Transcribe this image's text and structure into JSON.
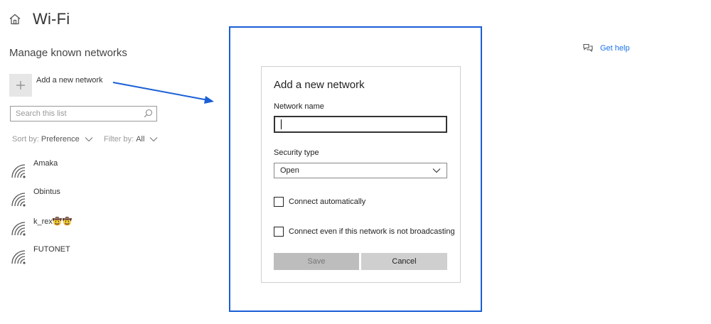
{
  "header": {
    "title": "Wi-Fi",
    "section_title": "Manage known networks"
  },
  "add_network": {
    "label": "Add a new network"
  },
  "search": {
    "placeholder": "Search this list",
    "value": ""
  },
  "sort": {
    "label": "Sort by:",
    "value": "Preference"
  },
  "filter": {
    "label": "Filter by:",
    "value": "All"
  },
  "networks": [
    {
      "name": "Amaka"
    },
    {
      "name": "Obintus"
    },
    {
      "name": "k_rex🤠🤠"
    },
    {
      "name": "FUTONET"
    }
  ],
  "help": {
    "label": "Get help"
  },
  "dialog": {
    "title": "Add a new network",
    "network_name_label": "Network name",
    "network_name_value": "",
    "security_type_label": "Security type",
    "security_type_value": "Open",
    "connect_auto_label": "Connect automatically",
    "connect_auto_checked": false,
    "connect_broadcast_label": "Connect even if this network is not broadcasting",
    "connect_broadcast_checked": false,
    "save_label": "Save",
    "cancel_label": "Cancel"
  },
  "colors": {
    "accent": "#1a73e8",
    "highlight_frame": "#1a5fd6",
    "tile_bg": "#e6e6e6",
    "disabled_button": "#bdbdbd",
    "button": "#cfcfcf"
  },
  "icons": {
    "home": "home-icon",
    "add": "plus-icon",
    "search": "search-icon",
    "wifi": "wifi-icon",
    "help": "chat-help-icon",
    "dropdown": "chevron-down-icon"
  }
}
